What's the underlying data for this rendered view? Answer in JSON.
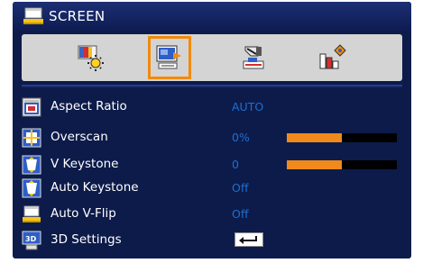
{
  "title": {
    "text": "SCREEN",
    "icon": "screen-menu-icon"
  },
  "tabs": [
    {
      "name": "image-settings-icon",
      "selected": false
    },
    {
      "name": "screen-settings-icon",
      "selected": true
    },
    {
      "name": "setting-tools-icon",
      "selected": false
    },
    {
      "name": "options-icon",
      "selected": false
    }
  ],
  "rows": [
    {
      "label": "Aspect Ratio",
      "value": "AUTO",
      "icon": "aspect-ratio-icon"
    },
    {
      "label": "Overscan",
      "value": "0%",
      "icon": "overscan-icon",
      "slider": 0.5
    },
    {
      "label": "V Keystone",
      "value": "0",
      "icon": "v-keystone-icon",
      "slider": 0.5
    },
    {
      "label": "Auto Keystone",
      "value": "Off",
      "icon": "auto-keystone-icon"
    },
    {
      "label": "Auto V-Flip",
      "value": "Off",
      "icon": "auto-v-flip-icon"
    },
    {
      "label": "3D Settings",
      "icon": "3d-settings-icon",
      "action": "enter-key-icon"
    }
  ],
  "colors": {
    "panel": "#0d1b4a",
    "selection": "#f28a0c",
    "value_text": "#1e6fd0",
    "slider_fill": "#f08a1c"
  }
}
